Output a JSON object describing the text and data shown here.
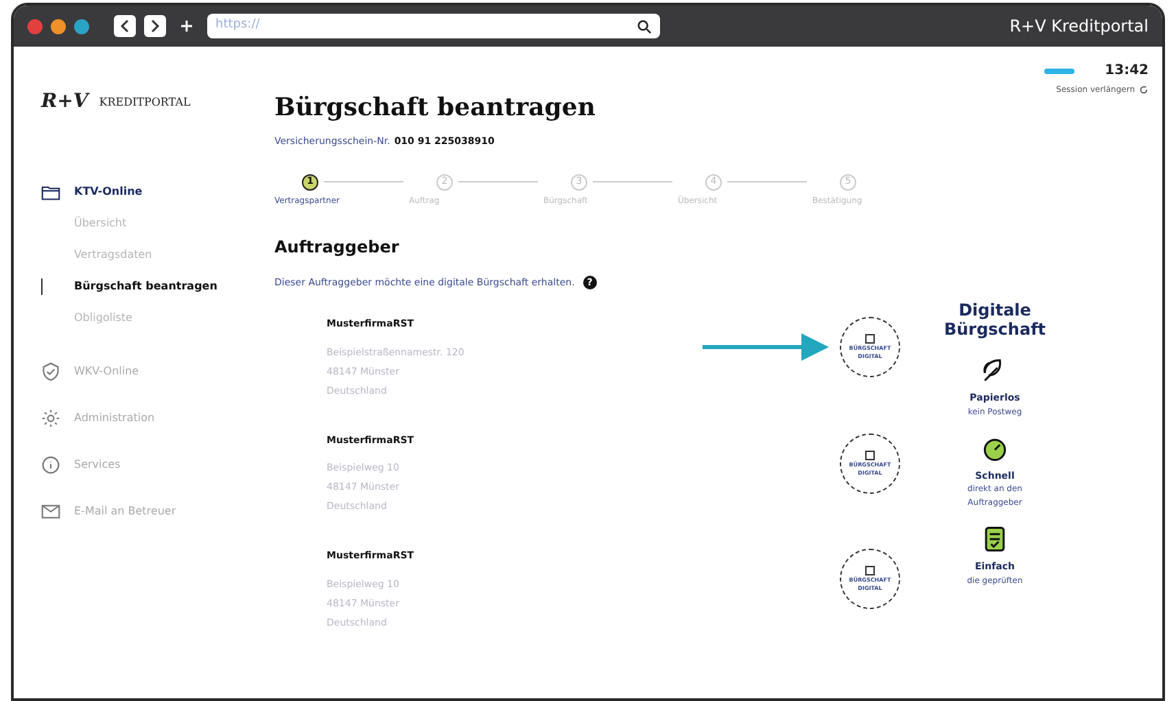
{
  "window": {
    "title": "R+V Kreditportal",
    "url": "https://"
  },
  "logo": {
    "mark": "R+V",
    "text": "KREDITPORTAL"
  },
  "session": {
    "time": "13:42",
    "action": "Session verlängern"
  },
  "sidebar": {
    "items": [
      {
        "label": "KTV-Online",
        "kind": "folder",
        "expanded": true,
        "children": [
          {
            "label": "Übersicht",
            "selected": false
          },
          {
            "label": "Vertragsdaten",
            "selected": false
          },
          {
            "label": "Bürgschaft beantragen",
            "selected": true
          },
          {
            "label": "Obligoliste",
            "selected": false
          }
        ]
      },
      {
        "label": "WKV-Online",
        "kind": "shield",
        "expanded": false
      },
      {
        "label": "Administration",
        "kind": "gear",
        "expanded": false
      },
      {
        "label": "Services",
        "kind": "info",
        "expanded": false
      },
      {
        "label": "E-Mail an Betreuer",
        "kind": "mail",
        "expanded": false
      }
    ]
  },
  "page": {
    "title": "Bürgschaft beantragen",
    "policy_label": "Versicherungsschein-Nr.",
    "policy_number": "010 91 225038910"
  },
  "stepper": [
    {
      "number": "1",
      "label": "Vertragspartner",
      "selected": true
    },
    {
      "number": "2",
      "label": "Auftrag",
      "selected": false
    },
    {
      "number": "3",
      "label": "Bürgschaft",
      "selected": false
    },
    {
      "number": "4",
      "label": "Übersicht",
      "selected": false
    },
    {
      "number": "5",
      "label": "Bestätigung",
      "selected": false
    }
  ],
  "section": {
    "title": "Auftraggeber",
    "description": "Dieser Auftraggeber möchte eine digitale Bürgschaft erhalten.",
    "help": "?"
  },
  "clients": [
    {
      "name": "MusterfirmaRST",
      "lines": [
        "Beispielstraßennamestr. 120",
        "48147 Münster",
        "Deutschland"
      ],
      "badge": [
        "BÜRGSCHAFT",
        "DIGITAL"
      ],
      "highlighted": true
    },
    {
      "name": "MusterfirmaRST",
      "lines": [
        "Beispielweg 10",
        "48147 Münster",
        "Deutschland"
      ],
      "badge": [
        "BÜRGSCHAFT",
        "DIGITAL"
      ],
      "highlighted": false
    },
    {
      "name": "MusterfirmaRST",
      "lines": [
        "Beispielweg 10",
        "48147 Münster",
        "Deutschland"
      ],
      "badge": [
        "BÜRGSCHAFT",
        "DIGITAL"
      ],
      "highlighted": false
    }
  ],
  "info_panel": {
    "title": "Digitale Bürgschaft",
    "features": [
      {
        "kind": "leaf",
        "title": "Papierlos",
        "text": "kein Postweg"
      },
      {
        "kind": "gauge",
        "title": "Schnell",
        "text": "direkt an den Auftraggeber"
      },
      {
        "kind": "clipboard",
        "title": "Einfach",
        "text": "die geprüften"
      }
    ]
  }
}
